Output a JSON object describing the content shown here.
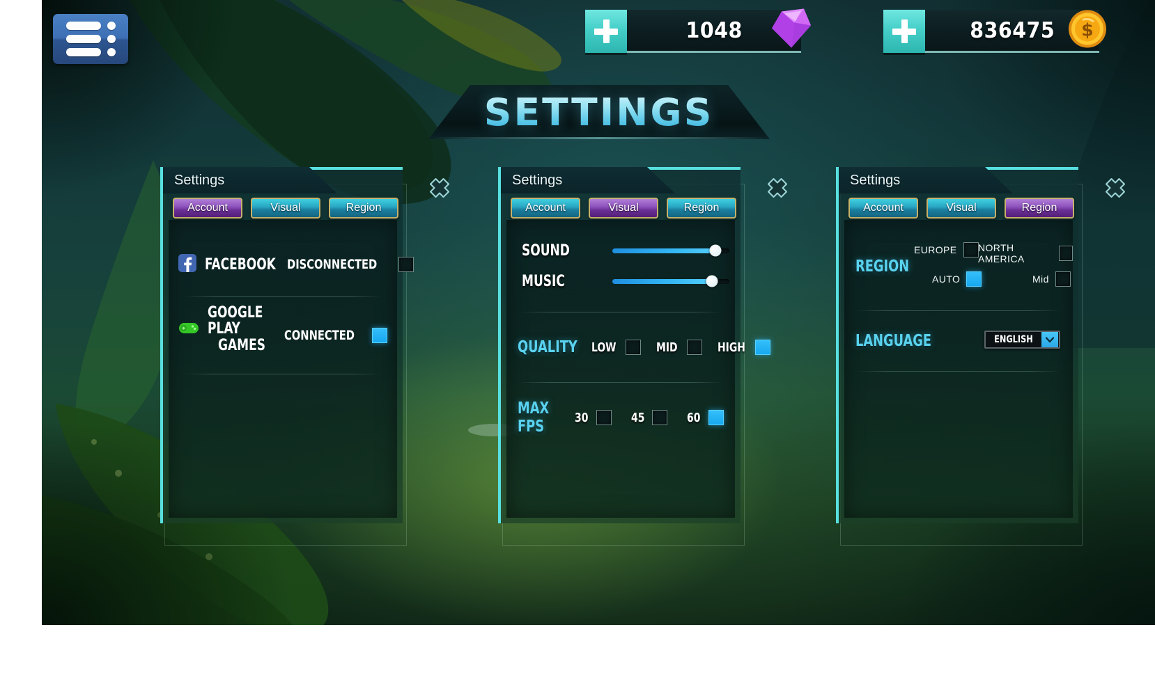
{
  "topbar": {
    "menu_icon": "hamburger-menu-icon",
    "gems": {
      "value": "1048",
      "icon": "gem-icon",
      "plus_label": "+"
    },
    "coins": {
      "value": "836475",
      "icon": "coin-icon",
      "plus_label": "+"
    }
  },
  "page_title": "SETTINGS",
  "panels": [
    {
      "header": "Settings",
      "close_icon": "close-x-icon",
      "tabs": [
        {
          "label": "Account",
          "active": true
        },
        {
          "label": "Visual",
          "active": false
        },
        {
          "label": "Region",
          "active": false
        }
      ],
      "account": {
        "rows": [
          {
            "icon": "facebook-icon",
            "name": "FACEBOOK",
            "status": "DISCONNECTED",
            "checked": false
          },
          {
            "icon": "google-play-games-icon",
            "name_line1": "GOOGLE PLAY",
            "name_line2": "GAMES",
            "status": "CONNECTED",
            "checked": true
          }
        ]
      }
    },
    {
      "header": "Settings",
      "close_icon": "close-x-icon",
      "tabs": [
        {
          "label": "Account",
          "active": false
        },
        {
          "label": "Visual",
          "active": true
        },
        {
          "label": "Region",
          "active": false
        }
      ],
      "visual": {
        "sliders": [
          {
            "label": "SOUND",
            "value": 88
          },
          {
            "label": "MUSIC",
            "value": 85
          }
        ],
        "quality": {
          "label": "QUALITY",
          "options": [
            {
              "label": "LOW",
              "checked": false
            },
            {
              "label": "MID",
              "checked": false
            },
            {
              "label": "HIGH",
              "checked": true
            }
          ]
        },
        "max_fps": {
          "label": "MAX FPS",
          "options": [
            {
              "label": "30",
              "checked": false
            },
            {
              "label": "45",
              "checked": false
            },
            {
              "label": "60",
              "checked": true
            }
          ]
        }
      }
    },
    {
      "header": "Settings",
      "close_icon": "close-x-icon",
      "tabs": [
        {
          "label": "Account",
          "active": false
        },
        {
          "label": "Visual",
          "active": false
        },
        {
          "label": "Region",
          "active": true
        }
      ],
      "region": {
        "label": "REGION",
        "options": [
          {
            "label": "EUROPE",
            "checked": false
          },
          {
            "label": "NORTH AMERICA",
            "checked": false
          },
          {
            "label": "AUTO",
            "checked": true
          },
          {
            "label": "Mid",
            "checked": false
          }
        ],
        "language": {
          "label": "LANGUAGE",
          "value": "ENGLISH",
          "arrow_icon": "chevron-down-icon"
        }
      }
    }
  ],
  "colors": {
    "accent_cyan": "#58e0e0",
    "checkbox_on": "#29b8f5",
    "tab_active": "#8e52bd",
    "tab_inactive": "#29a8c4",
    "title_text": "#a5e9f6",
    "facebook_blue": "#4267b2",
    "google_play_green": "#34c726",
    "gem_purple": "#b84ce0",
    "coin_gold": "#f5b322"
  }
}
